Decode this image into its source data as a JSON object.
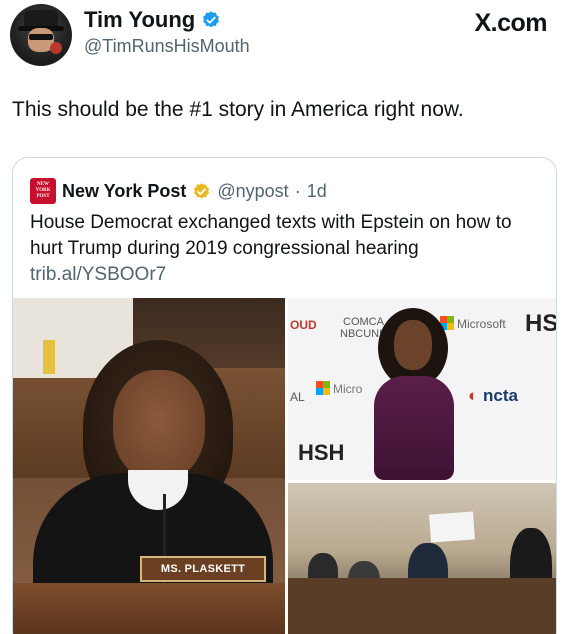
{
  "author": {
    "display_name": "Tim Young",
    "handle": "@TimRunsHisMouth",
    "verified_icon": "blue-check-icon",
    "avatar_icon": "user-avatar"
  },
  "brand": "X.com",
  "tweet_text": "This should be the #1 story in America right now.",
  "quoted": {
    "display_name": "New York Post",
    "handle": "@nypost",
    "separator": "·",
    "time": "1d",
    "logo_text": [
      "NEW",
      "YORK",
      "POST"
    ],
    "badge_icon": "gold-check-icon",
    "body": "House Democrat exchanged texts with Epstein on how to hurt Trump during 2019 congressional hearing",
    "link": "trib.al/YSBOOr7"
  },
  "media": {
    "nameplate": "MS. PLASKETT",
    "backdrop_logos": {
      "oud": "OUD",
      "comcast": "COMCA",
      "nbcuni": "NBCUNI",
      "microsoft": "Microsoft",
      "hs": "HS",
      "al": "AL",
      "micro": "Micro",
      "ncta": "ncta",
      "hsh": "HSH"
    }
  },
  "colors": {
    "verified_blue": "#1d9bf0",
    "gold_badge": "#e8b923",
    "nyp_red": "#c8102e",
    "secondary_text": "#536471"
  }
}
